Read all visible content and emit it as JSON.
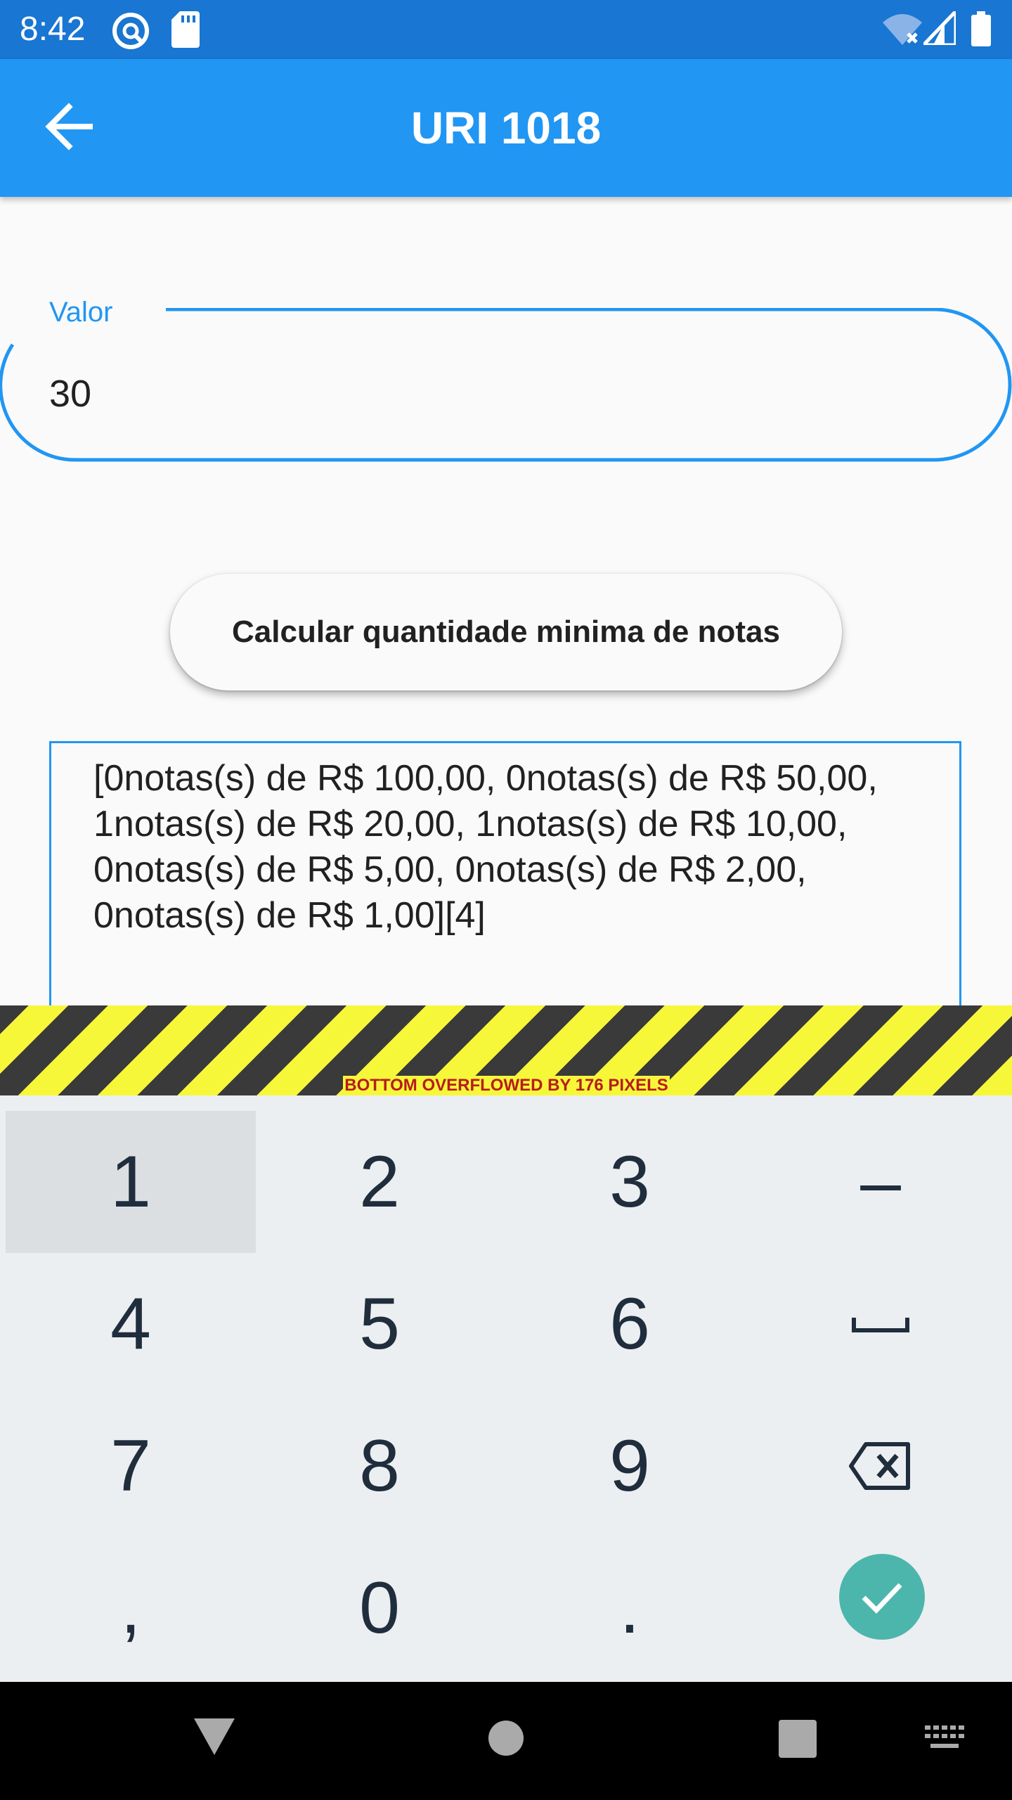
{
  "status_bar": {
    "time": "8:42"
  },
  "app_bar": {
    "title": "URI 1018"
  },
  "form": {
    "label": "Valor",
    "value": "30"
  },
  "button": {
    "label": "Calcular quantidade minima de notas"
  },
  "result": {
    "line1": "[0notas(s) de R$ 100,00, 0notas(s) de R$ 50,00,",
    "line2": "1notas(s) de R$ 20,00, 1notas(s) de R$ 10,00,",
    "line3": "0notas(s) de R$ 5,00, 0notas(s) de R$ 2,00,",
    "line4": "0notas(s) de R$ 1,00][4]"
  },
  "overflow_warning": "BOTTOM OVERFLOWED BY 176 PIXELS",
  "keyboard": {
    "row1": [
      "1",
      "2",
      "3",
      "–"
    ],
    "row2": [
      "4",
      "5",
      "6",
      "space-icon"
    ],
    "row3": [
      "7",
      "8",
      "9",
      "backspace-icon"
    ],
    "row4": [
      ",",
      "0",
      ".",
      "check-icon"
    ]
  },
  "colors": {
    "status_bar": "#1976d2",
    "app_bar": "#2196f3",
    "accent": "#2196f3",
    "keyboard_bg": "#eceff1",
    "confirm_key": "#4db6ac",
    "warning_yellow": "#f7f73a",
    "warning_text": "#b71c1c"
  }
}
